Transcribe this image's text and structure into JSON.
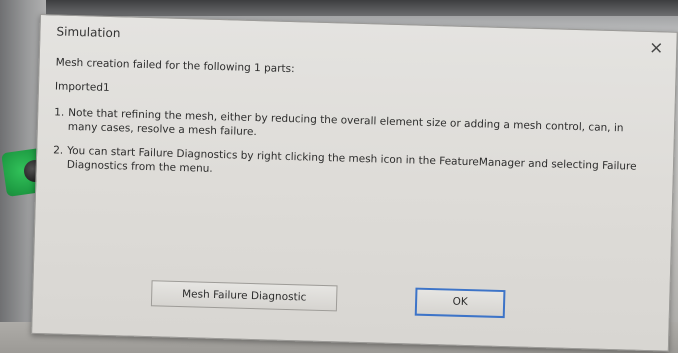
{
  "dialog": {
    "title": "Simulation",
    "close_symbol": "×",
    "heading": "Mesh creation failed for the following 1 parts:",
    "part_name": "Imported1",
    "notes": [
      {
        "number": "1.",
        "text": "Note that refining the mesh, either by reducing the overall element size or adding a mesh control, can, in many cases, resolve a mesh failure."
      },
      {
        "number": "2.",
        "text": "You can start Failure Diagnostics by right clicking the mesh icon in the FeatureManager and selecting Failure Diagnostics from the menu."
      }
    ],
    "buttons": {
      "diagnostic_label": "Mesh Failure Diagnostic",
      "ok_label": "OK"
    }
  },
  "colors": {
    "dialog_background": "#e0dfdc",
    "default_button_border": "#3d74c8",
    "background_accent_green": "#1e9c43"
  },
  "icons": {
    "close": "close-icon"
  }
}
